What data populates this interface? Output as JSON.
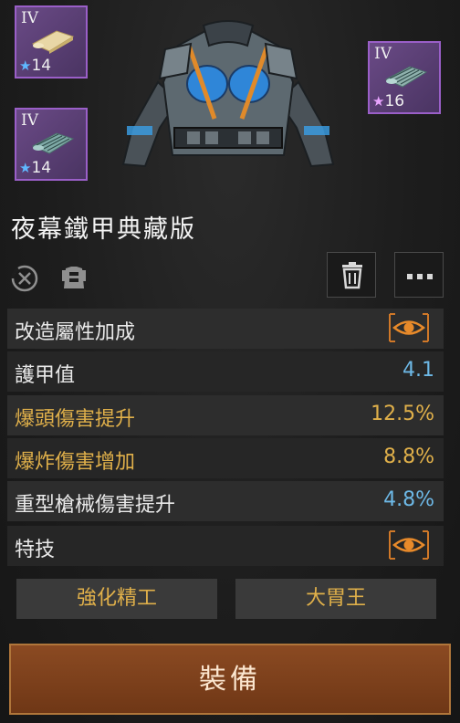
{
  "materials": [
    {
      "tier": "IV",
      "qty": "14"
    },
    {
      "tier": "IV",
      "qty": "14"
    },
    {
      "tier": "IV",
      "qty": "16"
    }
  ],
  "item": {
    "name": "夜幕鐵甲典藏版"
  },
  "stats": {
    "header": "改造屬性加成",
    "rows": [
      {
        "label": "護甲值",
        "value": "4.1"
      },
      {
        "label": "爆頭傷害提升",
        "value": "12.5%"
      },
      {
        "label": "爆炸傷害增加",
        "value": "8.8%"
      },
      {
        "label": "重型槍械傷害提升",
        "value": "4.8%"
      }
    ]
  },
  "perks": {
    "header": "特技",
    "items": [
      "強化精工",
      "大胃王"
    ]
  },
  "actions": {
    "equip": "裝備"
  },
  "icons": [
    "cancel-circle-icon",
    "armor-slot-icon",
    "trash-icon",
    "more-icon",
    "eye-icon"
  ],
  "colors": {
    "gold": "#e0b04a",
    "blue": "#6db8e6",
    "purple_frame": "#9a5fc8",
    "equip_bg": "#8b4a22"
  }
}
